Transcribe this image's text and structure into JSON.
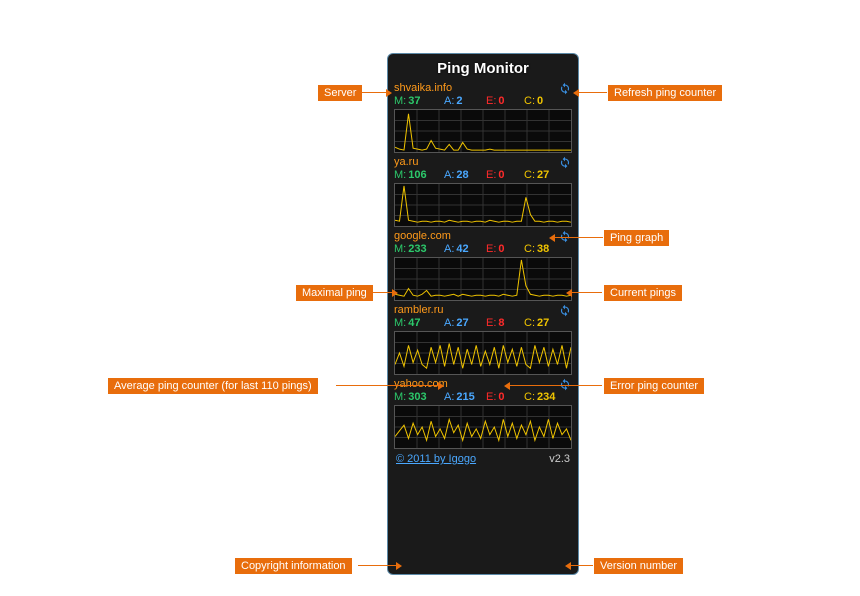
{
  "title": "Ping Monitor",
  "servers": [
    {
      "name": "shvaika.info",
      "m": "37",
      "a": "2",
      "e": "0",
      "c": "0",
      "graph": [
        5,
        3,
        2,
        40,
        4,
        3,
        2,
        3,
        12,
        4,
        3,
        2,
        8,
        2,
        2,
        10,
        3,
        2,
        2,
        2,
        2,
        3,
        2,
        2,
        2,
        2,
        2,
        2,
        2,
        2,
        2,
        2,
        2,
        2,
        2,
        2,
        2,
        2,
        2,
        2
      ]
    },
    {
      "name": "ya.ru",
      "m": "106",
      "a": "28",
      "e": "0",
      "c": "27",
      "graph": [
        6,
        5,
        42,
        6,
        5,
        4,
        5,
        5,
        4,
        5,
        5,
        4,
        6,
        5,
        4,
        5,
        5,
        4,
        5,
        5,
        4,
        6,
        5,
        4,
        5,
        5,
        4,
        5,
        5,
        30,
        12,
        5,
        5,
        4,
        5,
        5,
        4,
        5,
        5,
        4
      ]
    },
    {
      "name": "google.com",
      "m": "233",
      "a": "42",
      "e": "0",
      "c": "38",
      "graph": [
        6,
        5,
        4,
        12,
        5,
        4,
        6,
        10,
        4,
        5,
        5,
        4,
        5,
        6,
        4,
        6,
        5,
        4,
        5,
        5,
        4,
        5,
        5,
        4,
        6,
        5,
        4,
        5,
        42,
        15,
        6,
        5,
        4,
        5,
        5,
        4,
        5,
        5,
        4,
        5
      ]
    },
    {
      "name": "rambler.ru",
      "m": "47",
      "a": "27",
      "e": "8",
      "c": "27",
      "graph": [
        10,
        22,
        8,
        30,
        12,
        25,
        10,
        6,
        28,
        12,
        30,
        8,
        32,
        10,
        28,
        6,
        26,
        10,
        30,
        8,
        24,
        10,
        28,
        6,
        30,
        12,
        26,
        8,
        28,
        10,
        6,
        30,
        12,
        28,
        8,
        26,
        10,
        30,
        6,
        28
      ]
    },
    {
      "name": "yahoo.com",
      "m": "303",
      "a": "215",
      "e": "0",
      "c": "234",
      "graph": [
        12,
        18,
        24,
        10,
        26,
        14,
        22,
        8,
        28,
        12,
        20,
        10,
        30,
        16,
        24,
        8,
        26,
        12,
        20,
        10,
        28,
        14,
        22,
        8,
        30,
        12,
        26,
        10,
        24,
        14,
        28,
        8,
        22,
        12,
        30,
        10,
        26,
        14,
        20,
        8
      ]
    }
  ],
  "stat_labels": {
    "m": "M:",
    "a": "A:",
    "e": "E:",
    "c": "C:"
  },
  "footer": {
    "copyright": "© 2011 by Igogo",
    "version": "v2.3"
  },
  "icons": {
    "refresh": "refresh-icon"
  },
  "callouts": {
    "server": "Server",
    "refresh": "Refresh ping counter",
    "ping_graph": "Ping graph",
    "maximal": "Maximal ping",
    "current": "Current pings",
    "average": "Average ping counter (for last 110 pings)",
    "error": "Error ping counter",
    "copyright": "Copyright information",
    "version": "Version number"
  }
}
